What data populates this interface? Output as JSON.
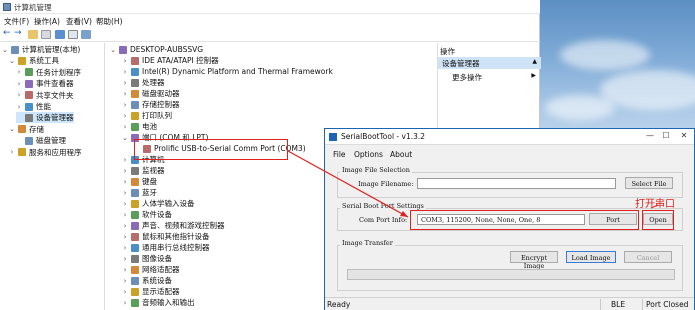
{
  "devmgr": {
    "title": "计算机管理",
    "menu": [
      "文件(F)",
      "操作(A)",
      "查看(V)",
      "帮助(H)"
    ],
    "left_tree": [
      {
        "label": "计算机管理(本地)",
        "icon": "computer-management-icon"
      },
      {
        "label": "系统工具",
        "icon": "tools-icon"
      },
      {
        "label": "任务计划程序",
        "icon": "task-scheduler-icon"
      },
      {
        "label": "事件查看器",
        "icon": "event-viewer-icon"
      },
      {
        "label": "共享文件夹",
        "icon": "shared-folder-icon"
      },
      {
        "label": "性能",
        "icon": "performance-icon"
      },
      {
        "label": "设备管理器",
        "icon": "device-manager-icon",
        "selected": true
      },
      {
        "label": "存储",
        "icon": "storage-icon"
      },
      {
        "label": "磁盘管理",
        "icon": "disk-icon"
      },
      {
        "label": "服务和应用程序",
        "icon": "services-icon"
      }
    ],
    "device_tree": [
      {
        "label": "DESKTOP-AUBSSVG",
        "icon": "computer-icon",
        "expanded": true
      },
      {
        "label": "IDE ATA/ATAPI 控制器",
        "icon": "ide-controller-icon"
      },
      {
        "label": "Intel(R) Dynamic Platform and Thermal Framework",
        "icon": "intel-icon"
      },
      {
        "label": "处理器",
        "icon": "processor-icon"
      },
      {
        "label": "磁盘驱动器",
        "icon": "disk-drive-icon"
      },
      {
        "label": "存储控制器",
        "icon": "storage-controller-icon"
      },
      {
        "label": "打印队列",
        "icon": "printer-icon"
      },
      {
        "label": "电池",
        "icon": "battery-icon"
      },
      {
        "label": "端口 (COM 和 LPT)",
        "icon": "port-icon",
        "expanded": true
      },
      {
        "label": "Prolific USB-to-Serial Comm Port (COM3)",
        "icon": "serial-port-icon",
        "child": true
      },
      {
        "label": "计算机",
        "icon": "computer-icon"
      },
      {
        "label": "监视器",
        "icon": "monitor-icon"
      },
      {
        "label": "键盘",
        "icon": "keyboard-icon"
      },
      {
        "label": "蓝牙",
        "icon": "bluetooth-icon"
      },
      {
        "label": "人体学输入设备",
        "icon": "hid-icon"
      },
      {
        "label": "软件设备",
        "icon": "software-device-icon"
      },
      {
        "label": "声音、视频和游戏控制器",
        "icon": "sound-icon"
      },
      {
        "label": "鼠标和其他指针设备",
        "icon": "mouse-icon"
      },
      {
        "label": "通用串行总线控制器",
        "icon": "usb-icon"
      },
      {
        "label": "图像设备",
        "icon": "camera-icon"
      },
      {
        "label": "网络适配器",
        "icon": "network-icon"
      },
      {
        "label": "系统设备",
        "icon": "system-device-icon"
      },
      {
        "label": "显示适配器",
        "icon": "display-adapter-icon"
      },
      {
        "label": "音频输入和输出",
        "icon": "audio-io-icon"
      }
    ],
    "actions": {
      "header": "操作",
      "selected": "设备管理器",
      "more": "更多操作"
    }
  },
  "sbt": {
    "title": "SerialBootTool - v1.3.2",
    "menu": [
      "File",
      "Options",
      "About"
    ],
    "image_group": "Image File Selection",
    "image_label": "Image Filename:",
    "image_value": "",
    "select_file": "Select File",
    "port_group": "Serial Boot Port Settings",
    "port_label": "Com Port Info:",
    "port_value": "COM3, 115200, None, None, One, 8",
    "port_button": "Port",
    "open_button": "Open",
    "transfer_group": "Image Transfer",
    "encrypt": "Encrypt Image",
    "load": "Load Image",
    "cancel": "Cancel",
    "status_ready": "Ready",
    "status_ble": "BLE",
    "status_port": "Port Closed"
  },
  "annotation": {
    "open_port": "打开串口",
    "color": "#e0201c"
  }
}
